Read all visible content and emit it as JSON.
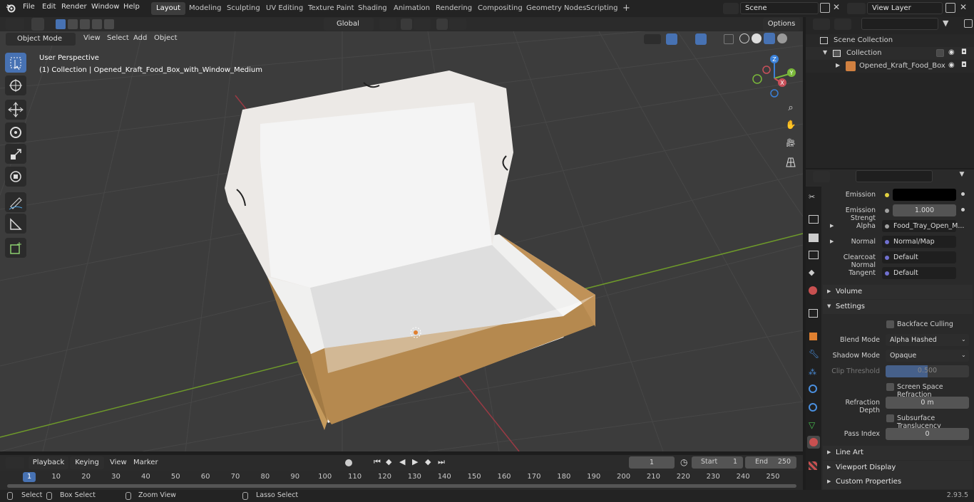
{
  "menu": [
    "File",
    "Edit",
    "Render",
    "Window",
    "Help"
  ],
  "workspaces": [
    "Layout",
    "Modeling",
    "Sculpting",
    "UV Editing",
    "Texture Paint",
    "Shading",
    "Animation",
    "Rendering",
    "Compositing",
    "Geometry Nodes",
    "Scripting"
  ],
  "active_workspace": "Layout",
  "scene_name": "Scene",
  "view_layer": "View Layer",
  "viewport_header": {
    "mode": "Object Mode",
    "menus": [
      "View",
      "Select",
      "Add",
      "Object"
    ],
    "transform": "Global",
    "options": "Options"
  },
  "viewport": {
    "perspective": "User Perspective",
    "collection_info": "(1) Collection | Opened_Kraft_Food_Box_with_Window_Medium",
    "gizmo_labels": [
      "Z",
      "Y",
      "X"
    ]
  },
  "outliner": {
    "scene_collection": "Scene Collection",
    "collection": "Collection",
    "object": "Opened_Kraft_Food_Box"
  },
  "properties": {
    "emission_label": "Emission",
    "emission_strength_label": "Emission Strengt",
    "emission_strength_value": "1.000",
    "alpha_label": "Alpha",
    "alpha_value": "Food_Tray_Open_M...",
    "normal_label": "Normal",
    "normal_value": "Normal/Map",
    "clearcoat_label": "Clearcoat Normal",
    "clearcoat_value": "Default",
    "tangent_label": "Tangent",
    "tangent_value": "Default",
    "volume": "Volume",
    "settings": "Settings",
    "backface_culling": "Backface Culling",
    "blend_mode_label": "Blend Mode",
    "blend_mode_value": "Alpha Hashed",
    "shadow_mode_label": "Shadow Mode",
    "shadow_mode_value": "Opaque",
    "clip_threshold_label": "Clip Threshold",
    "clip_threshold_value": "0.500",
    "clip_threshold_fraction": 0.5,
    "screen_space_refraction": "Screen Space Refraction",
    "refraction_depth_label": "Refraction Depth",
    "refraction_depth_value": "0 m",
    "subsurface_translucency": "Subsurface Translucency",
    "pass_index_label": "Pass Index",
    "pass_index_value": "0",
    "line_art": "Line Art",
    "viewport_display": "Viewport Display",
    "custom_properties": "Custom Properties"
  },
  "timeline": {
    "menus": [
      "Playback",
      "Keying",
      "View",
      "Marker"
    ],
    "current_frame": "1",
    "start_label": "Start",
    "start_value": "1",
    "end_label": "End",
    "end_value": "250",
    "ticks": [
      "1",
      "10",
      "20",
      "30",
      "40",
      "50",
      "60",
      "70",
      "80",
      "90",
      "100",
      "110",
      "120",
      "130",
      "140",
      "150",
      "160",
      "170",
      "180",
      "190",
      "200",
      "210",
      "220",
      "230",
      "240",
      "250"
    ]
  },
  "statusbar": {
    "select": "Select",
    "box_select": "Box Select",
    "zoom_view": "Zoom View",
    "lasso_select": "Lasso Select",
    "version": "2.93.5"
  },
  "colors": {
    "accent": "#4772b3",
    "viewport_bg": "#3c3c3c",
    "kraft": "#b5894f",
    "box_inner": "#e8e8e6",
    "x_axis": "#c8505a",
    "y_axis": "#7ab83a",
    "z_axis": "#3a80d8"
  }
}
